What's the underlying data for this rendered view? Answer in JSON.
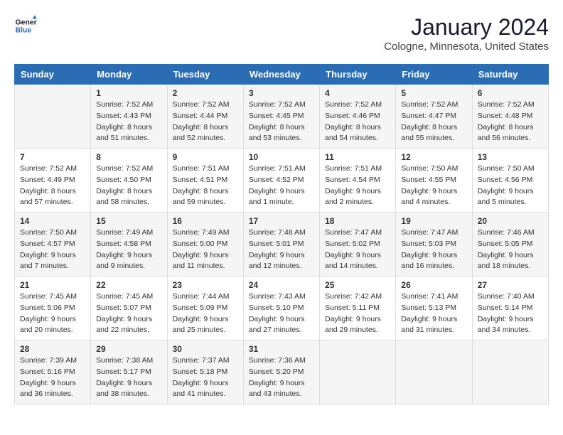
{
  "logo": {
    "line1": "General",
    "line2": "Blue"
  },
  "title": "January 2024",
  "subtitle": "Cologne, Minnesota, United States",
  "days_of_week": [
    "Sunday",
    "Monday",
    "Tuesday",
    "Wednesday",
    "Thursday",
    "Friday",
    "Saturday"
  ],
  "weeks": [
    [
      {
        "day": "",
        "info": ""
      },
      {
        "day": "1",
        "info": "Sunrise: 7:52 AM\nSunset: 4:43 PM\nDaylight: 8 hours\nand 51 minutes."
      },
      {
        "day": "2",
        "info": "Sunrise: 7:52 AM\nSunset: 4:44 PM\nDaylight: 8 hours\nand 52 minutes."
      },
      {
        "day": "3",
        "info": "Sunrise: 7:52 AM\nSunset: 4:45 PM\nDaylight: 8 hours\nand 53 minutes."
      },
      {
        "day": "4",
        "info": "Sunrise: 7:52 AM\nSunset: 4:46 PM\nDaylight: 8 hours\nand 54 minutes."
      },
      {
        "day": "5",
        "info": "Sunrise: 7:52 AM\nSunset: 4:47 PM\nDaylight: 8 hours\nand 55 minutes."
      },
      {
        "day": "6",
        "info": "Sunrise: 7:52 AM\nSunset: 4:48 PM\nDaylight: 8 hours\nand 56 minutes."
      }
    ],
    [
      {
        "day": "7",
        "info": "Sunrise: 7:52 AM\nSunset: 4:49 PM\nDaylight: 8 hours\nand 57 minutes."
      },
      {
        "day": "8",
        "info": "Sunrise: 7:52 AM\nSunset: 4:50 PM\nDaylight: 8 hours\nand 58 minutes."
      },
      {
        "day": "9",
        "info": "Sunrise: 7:51 AM\nSunset: 4:51 PM\nDaylight: 8 hours\nand 59 minutes."
      },
      {
        "day": "10",
        "info": "Sunrise: 7:51 AM\nSunset: 4:52 PM\nDaylight: 9 hours\nand 1 minute."
      },
      {
        "day": "11",
        "info": "Sunrise: 7:51 AM\nSunset: 4:54 PM\nDaylight: 9 hours\nand 2 minutes."
      },
      {
        "day": "12",
        "info": "Sunrise: 7:50 AM\nSunset: 4:55 PM\nDaylight: 9 hours\nand 4 minutes."
      },
      {
        "day": "13",
        "info": "Sunrise: 7:50 AM\nSunset: 4:56 PM\nDaylight: 9 hours\nand 5 minutes."
      }
    ],
    [
      {
        "day": "14",
        "info": "Sunrise: 7:50 AM\nSunset: 4:57 PM\nDaylight: 9 hours\nand 7 minutes."
      },
      {
        "day": "15",
        "info": "Sunrise: 7:49 AM\nSunset: 4:58 PM\nDaylight: 9 hours\nand 9 minutes."
      },
      {
        "day": "16",
        "info": "Sunrise: 7:49 AM\nSunset: 5:00 PM\nDaylight: 9 hours\nand 11 minutes."
      },
      {
        "day": "17",
        "info": "Sunrise: 7:48 AM\nSunset: 5:01 PM\nDaylight: 9 hours\nand 12 minutes."
      },
      {
        "day": "18",
        "info": "Sunrise: 7:47 AM\nSunset: 5:02 PM\nDaylight: 9 hours\nand 14 minutes."
      },
      {
        "day": "19",
        "info": "Sunrise: 7:47 AM\nSunset: 5:03 PM\nDaylight: 9 hours\nand 16 minutes."
      },
      {
        "day": "20",
        "info": "Sunrise: 7:46 AM\nSunset: 5:05 PM\nDaylight: 9 hours\nand 18 minutes."
      }
    ],
    [
      {
        "day": "21",
        "info": "Sunrise: 7:45 AM\nSunset: 5:06 PM\nDaylight: 9 hours\nand 20 minutes."
      },
      {
        "day": "22",
        "info": "Sunrise: 7:45 AM\nSunset: 5:07 PM\nDaylight: 9 hours\nand 22 minutes."
      },
      {
        "day": "23",
        "info": "Sunrise: 7:44 AM\nSunset: 5:09 PM\nDaylight: 9 hours\nand 25 minutes."
      },
      {
        "day": "24",
        "info": "Sunrise: 7:43 AM\nSunset: 5:10 PM\nDaylight: 9 hours\nand 27 minutes."
      },
      {
        "day": "25",
        "info": "Sunrise: 7:42 AM\nSunset: 5:11 PM\nDaylight: 9 hours\nand 29 minutes."
      },
      {
        "day": "26",
        "info": "Sunrise: 7:41 AM\nSunset: 5:13 PM\nDaylight: 9 hours\nand 31 minutes."
      },
      {
        "day": "27",
        "info": "Sunrise: 7:40 AM\nSunset: 5:14 PM\nDaylight: 9 hours\nand 34 minutes."
      }
    ],
    [
      {
        "day": "28",
        "info": "Sunrise: 7:39 AM\nSunset: 5:16 PM\nDaylight: 9 hours\nand 36 minutes."
      },
      {
        "day": "29",
        "info": "Sunrise: 7:38 AM\nSunset: 5:17 PM\nDaylight: 9 hours\nand 38 minutes."
      },
      {
        "day": "30",
        "info": "Sunrise: 7:37 AM\nSunset: 5:18 PM\nDaylight: 9 hours\nand 41 minutes."
      },
      {
        "day": "31",
        "info": "Sunrise: 7:36 AM\nSunset: 5:20 PM\nDaylight: 9 hours\nand 43 minutes."
      },
      {
        "day": "",
        "info": ""
      },
      {
        "day": "",
        "info": ""
      },
      {
        "day": "",
        "info": ""
      }
    ]
  ]
}
